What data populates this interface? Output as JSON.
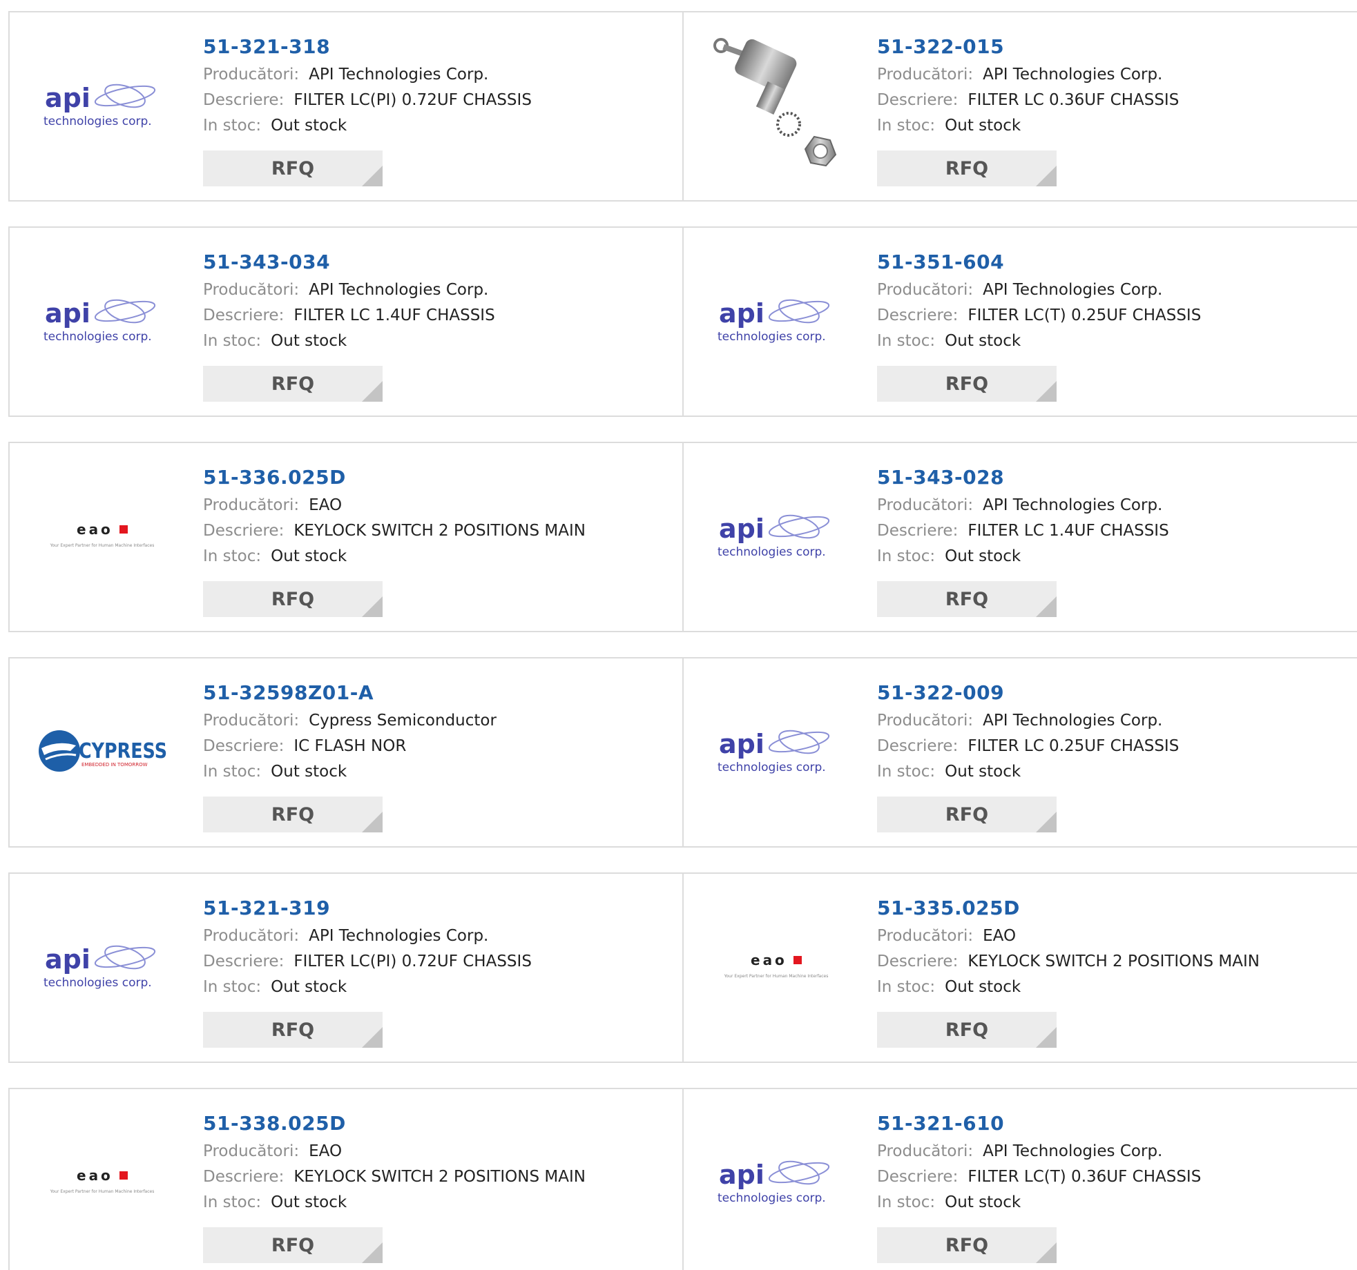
{
  "labels": {
    "manufacturer": "Producători:",
    "description": "Descriere:",
    "stock": "In stoc:"
  },
  "rfq_label": "RFQ",
  "colors": {
    "part_number": "#1f5fa8",
    "api_logo": "#3f42a8",
    "eao_red": "#e3171f",
    "cypress_blue": "#1e5fa8"
  },
  "logo_text": {
    "api_main": "api",
    "api_sub": "technologies corp.",
    "eao_main": "eao",
    "eao_sub": "Your Expert Partner for Human Machine Interfaces",
    "cypress_main": "CYPRESS",
    "cypress_sub": "EMBEDDED IN TOMORROW"
  },
  "products": [
    {
      "part": "51-321-318",
      "manufacturer": "API Technologies Corp.",
      "description": "FILTER LC(PI) 0.72UF CHASSIS",
      "stock": "Out stock",
      "logo": "api-logo"
    },
    {
      "part": "51-322-015",
      "manufacturer": "API Technologies Corp.",
      "description": "FILTER LC 0.36UF CHASSIS",
      "stock": "Out stock",
      "logo": "product-photo"
    },
    {
      "part": "51-343-034",
      "manufacturer": "API Technologies Corp.",
      "description": "FILTER LC 1.4UF CHASSIS",
      "stock": "Out stock",
      "logo": "api-logo"
    },
    {
      "part": "51-351-604",
      "manufacturer": "API Technologies Corp.",
      "description": "FILTER LC(T) 0.25UF CHASSIS",
      "stock": "Out stock",
      "logo": "api-logo"
    },
    {
      "part": "51-336.025D",
      "manufacturer": "EAO",
      "description": "KEYLOCK SWITCH 2 POSITIONS MAIN",
      "stock": "Out stock",
      "logo": "eao-logo"
    },
    {
      "part": "51-343-028",
      "manufacturer": "API Technologies Corp.",
      "description": "FILTER LC 1.4UF CHASSIS",
      "stock": "Out stock",
      "logo": "api-logo"
    },
    {
      "part": "51-32598Z01-A",
      "manufacturer": "Cypress Semiconductor",
      "description": "IC FLASH NOR",
      "stock": "Out stock",
      "logo": "cypress-logo"
    },
    {
      "part": "51-322-009",
      "manufacturer": "API Technologies Corp.",
      "description": "FILTER LC 0.25UF CHASSIS",
      "stock": "Out stock",
      "logo": "api-logo"
    },
    {
      "part": "51-321-319",
      "manufacturer": "API Technologies Corp.",
      "description": "FILTER LC(PI) 0.72UF CHASSIS",
      "stock": "Out stock",
      "logo": "api-logo"
    },
    {
      "part": "51-335.025D",
      "manufacturer": "EAO",
      "description": "KEYLOCK SWITCH 2 POSITIONS MAIN",
      "stock": "Out stock",
      "logo": "eao-logo"
    },
    {
      "part": "51-338.025D",
      "manufacturer": "EAO",
      "description": "KEYLOCK SWITCH 2 POSITIONS MAIN",
      "stock": "Out stock",
      "logo": "eao-logo"
    },
    {
      "part": "51-321-610",
      "manufacturer": "API Technologies Corp.",
      "description": "FILTER LC(T) 0.36UF CHASSIS",
      "stock": "Out stock",
      "logo": "api-logo"
    }
  ]
}
